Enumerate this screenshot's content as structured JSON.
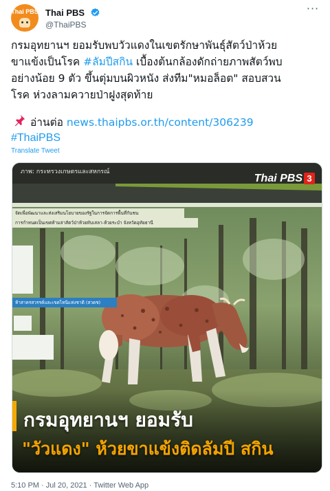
{
  "author": {
    "avatar_text": "Thai PBS",
    "display_name": "Thai PBS",
    "handle": "@ThaiPBS",
    "verified": true
  },
  "tweet": {
    "lines": [
      {
        "text": "กรมอุทยานฯ ยอมรับพบวัวแดงในเขตรักษาพันธุ์สัตว์ป่าห้วย"
      },
      {
        "pre": "ขาแข้งเป็นโรค ",
        "hashtag": "#ลัมปีสกิน",
        "post": " เบื้องต้นกล้องดักถ่ายภาพสัตว์พบ"
      },
      {
        "text": "อย่างน้อย 9 ตัว ขึ้นตุ่มบนผิวหนัง ส่งทีม\"หมอล็อต\" สอบสวน"
      },
      {
        "text": "โรค ห่วงลามควายป่าฝูงสุดท้าย"
      }
    ],
    "read_more_label": "อ่านต่อ",
    "read_more_link": "news.thaipbs.or.th/content/306239",
    "hashtag": "#ThaiPBS",
    "translate_label": "Translate Tweet",
    "timestamp": "5:10 PM · Jul 20, 2021 · Twitter Web App"
  },
  "media": {
    "credit": "ภาพ: กระทรวงเกษตรและสหกรณ์",
    "brand": "Thai PBS",
    "brand_number": "3",
    "banner_line_1": "จัดเพื่อพัฒนาและส่งเสริมนโยบายของรัฐในการจัดการพื้นที่กันชน",
    "banner_line_2": "การกำหนดเป็นเขตห้ามล่าสัตว์ป่าห้วยทับเสลา-ห้วยระบำ จังหวัดอุทัยธานี",
    "blue_tag": "ห้าสาครสวรรค์และเขตไทนิแห่งชาติ (สวดช)",
    "caption_line_1": "กรมอุทยานฯ ยอมรับ",
    "caption_line_2": "\"วัวแดง\" ห้วยขาแข้งติดลัมปี สกิน"
  },
  "colors": {
    "link": "#1d9bf0",
    "text": "#0f1419",
    "muted": "#536471",
    "avatar_bg": "#f28b1e",
    "caption_orange": "#f5a300"
  },
  "icons": {
    "verified": "verified-badge-icon",
    "more": "more-options-icon",
    "pin": "pushpin-icon"
  }
}
